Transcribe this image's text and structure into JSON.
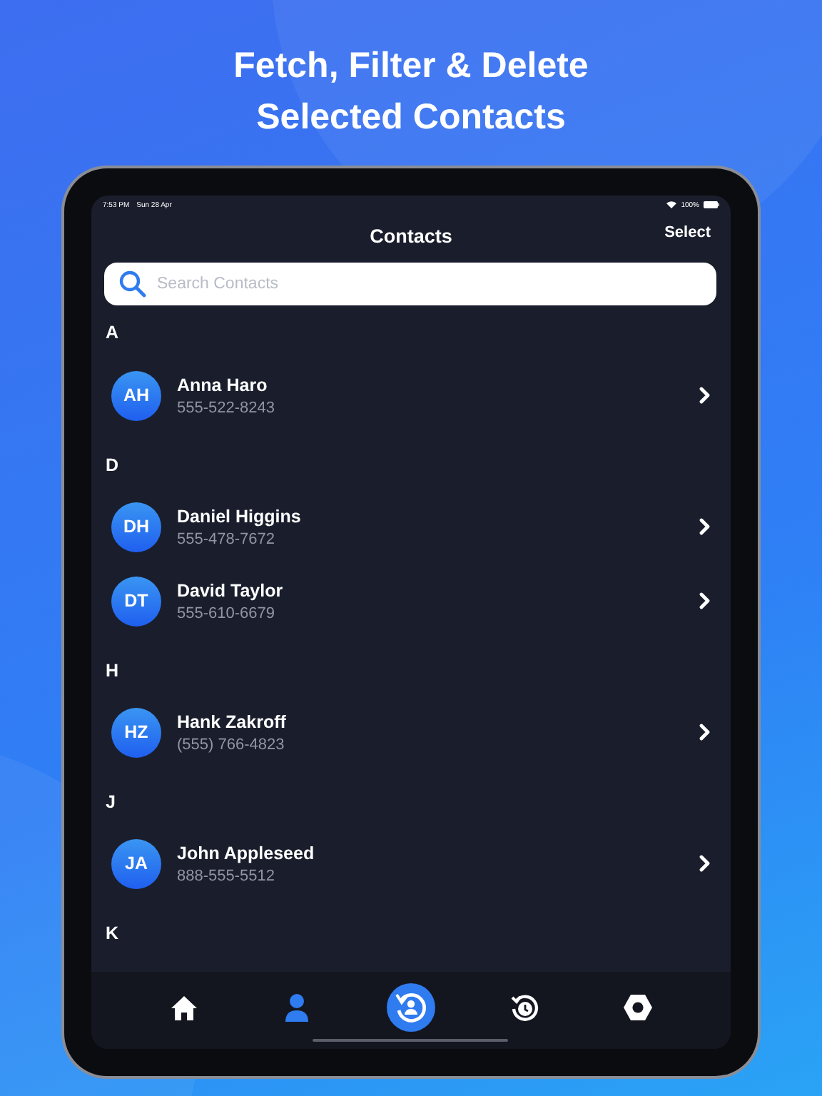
{
  "headline": [
    "Fetch, Filter & Delete",
    "Selected Contacts"
  ],
  "status_bar": {
    "time": "7:53 PM",
    "date": "Sun 28 Apr",
    "battery": "100%"
  },
  "nav": {
    "title": "Contacts",
    "action": "Select"
  },
  "search": {
    "placeholder": "Search Contacts"
  },
  "sections": [
    {
      "letter": "A",
      "contacts": [
        {
          "initials": "AH",
          "name": "Anna Haro",
          "phone": "555-522-8243"
        }
      ]
    },
    {
      "letter": "D",
      "contacts": [
        {
          "initials": "DH",
          "name": "Daniel Higgins",
          "phone": "555-478-7672"
        },
        {
          "initials": "DT",
          "name": "David Taylor",
          "phone": "555-610-6679"
        }
      ]
    },
    {
      "letter": "H",
      "contacts": [
        {
          "initials": "HZ",
          "name": "Hank Zakroff",
          "phone": "(555) 766-4823"
        }
      ]
    },
    {
      "letter": "J",
      "contacts": [
        {
          "initials": "JA",
          "name": "John Appleseed",
          "phone": "888-555-5512"
        }
      ]
    },
    {
      "letter": "K"
    }
  ],
  "tabs": [
    {
      "kind": "home",
      "selected": false
    },
    {
      "kind": "contacts",
      "selected": true
    },
    {
      "kind": "restore",
      "selected": false
    },
    {
      "kind": "history",
      "selected": false
    },
    {
      "kind": "settings",
      "selected": false
    }
  ]
}
